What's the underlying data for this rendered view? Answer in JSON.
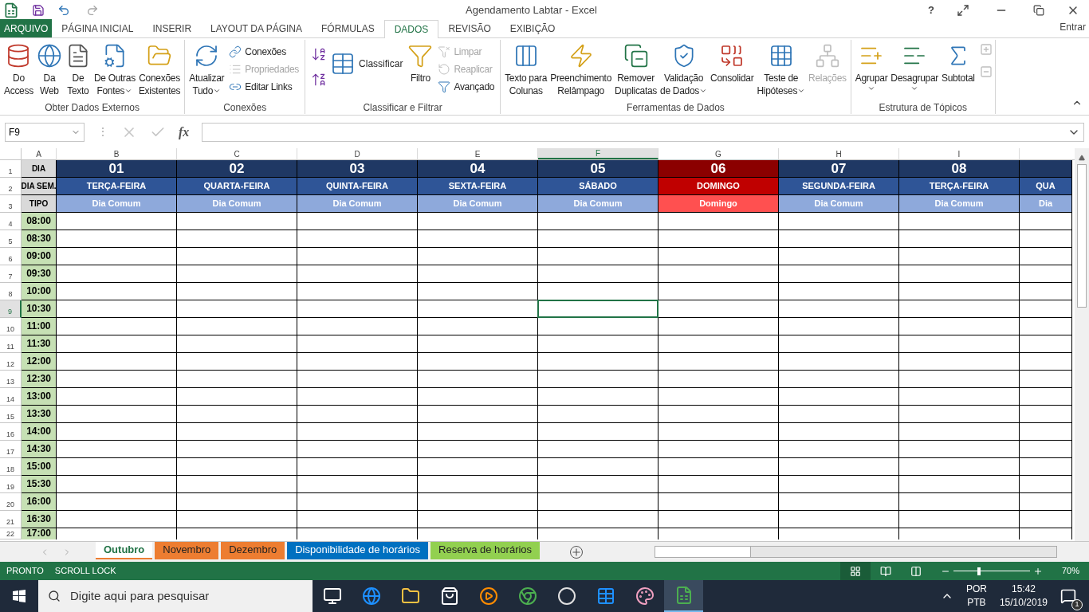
{
  "window": {
    "title": "Agendamento Labtar - Excel",
    "help": "?",
    "sign_in": "Entrar"
  },
  "tabs": [
    {
      "label": "ARQUIVO",
      "kind": "file",
      "selected": false
    },
    {
      "label": "PÁGINA INICIAL",
      "kind": "normal",
      "selected": false
    },
    {
      "label": "INSERIR",
      "kind": "normal",
      "selected": false
    },
    {
      "label": "LAYOUT DA PÁGINA",
      "kind": "normal",
      "selected": false
    },
    {
      "label": "FÓRMULAS",
      "kind": "normal",
      "selected": false
    },
    {
      "label": "DADOS",
      "kind": "normal",
      "selected": true
    },
    {
      "label": "REVISÃO",
      "kind": "normal",
      "selected": false
    },
    {
      "label": "EXIBIÇÃO",
      "kind": "normal",
      "selected": false
    }
  ],
  "ribbon": {
    "groups": [
      {
        "label": "Obter Dados Externos",
        "items": [
          {
            "kind": "large",
            "lines": [
              "Do",
              "Access"
            ],
            "dropdown": false,
            "disabled": false
          },
          {
            "kind": "large",
            "lines": [
              "Da",
              "Web"
            ],
            "dropdown": false,
            "disabled": false
          },
          {
            "kind": "large",
            "lines": [
              "De",
              "Texto"
            ],
            "dropdown": false,
            "disabled": false
          },
          {
            "kind": "large",
            "lines": [
              "De Outras",
              "Fontes"
            ],
            "dropdown": true,
            "disabled": false
          },
          {
            "kind": "large",
            "lines": [
              "Conexões",
              "Existentes"
            ],
            "dropdown": false,
            "disabled": false
          }
        ]
      },
      {
        "label": "Conexões",
        "items": [
          {
            "kind": "large",
            "lines": [
              "Atualizar",
              "Tudo"
            ],
            "dropdown": true,
            "disabled": false
          },
          {
            "kind": "small",
            "lines": [
              "Conexões"
            ],
            "dropdown": false,
            "disabled": false
          },
          {
            "kind": "small",
            "lines": [
              "Propriedades"
            ],
            "dropdown": false,
            "disabled": true
          },
          {
            "kind": "small",
            "lines": [
              "Editar Links"
            ],
            "dropdown": false,
            "disabled": false
          }
        ]
      },
      {
        "label": "Classificar e Filtrar",
        "items": [
          {
            "kind": "sortpair"
          },
          {
            "kind": "mid",
            "lines": [
              "Classificar"
            ],
            "dropdown": false,
            "disabled": false
          },
          {
            "kind": "large",
            "lines": [
              "Filtro"
            ],
            "dropdown": false,
            "disabled": false
          },
          {
            "kind": "small",
            "lines": [
              "Limpar"
            ],
            "dropdown": false,
            "disabled": true
          },
          {
            "kind": "small",
            "lines": [
              "Reaplicar"
            ],
            "dropdown": false,
            "disabled": true
          },
          {
            "kind": "small",
            "lines": [
              "Avançado"
            ],
            "dropdown": false,
            "disabled": false
          }
        ]
      },
      {
        "label": "Ferramentas de Dados",
        "items": [
          {
            "kind": "large",
            "lines": [
              "Texto para",
              "Colunas"
            ],
            "dropdown": false,
            "disabled": false
          },
          {
            "kind": "large",
            "lines": [
              "Preenchimento",
              "Relâmpago"
            ],
            "dropdown": false,
            "disabled": false
          },
          {
            "kind": "large",
            "lines": [
              "Remover",
              "Duplicatas"
            ],
            "dropdown": false,
            "disabled": false
          },
          {
            "kind": "large",
            "lines": [
              "Validação",
              "de Dados"
            ],
            "dropdown": true,
            "disabled": false
          },
          {
            "kind": "large",
            "lines": [
              "Consolidar"
            ],
            "dropdown": false,
            "disabled": false
          },
          {
            "kind": "large",
            "lines": [
              "Teste de",
              "Hipóteses"
            ],
            "dropdown": true,
            "disabled": false
          },
          {
            "kind": "large",
            "lines": [
              "Relações"
            ],
            "dropdown": false,
            "disabled": true
          }
        ]
      },
      {
        "label": "Estrutura de Tópicos",
        "items": [
          {
            "kind": "large",
            "lines": [
              "Agrupar"
            ],
            "dropdown": true,
            "disabled": false
          },
          {
            "kind": "large",
            "lines": [
              "Desagrupar"
            ],
            "dropdown": true,
            "disabled": false
          },
          {
            "kind": "large",
            "lines": [
              "Subtotal"
            ],
            "dropdown": false,
            "disabled": false
          },
          {
            "kind": "detail",
            "disabled": true
          }
        ]
      }
    ]
  },
  "formula_bar": {
    "name_box": "F9",
    "separator": "⋮",
    "function_label": "fx"
  },
  "sheet": {
    "columns": [
      {
        "letter": "A",
        "selected": false
      },
      {
        "letter": "B",
        "selected": false
      },
      {
        "letter": "C",
        "selected": false
      },
      {
        "letter": "D",
        "selected": false
      },
      {
        "letter": "E",
        "selected": false
      },
      {
        "letter": "F",
        "selected": true
      },
      {
        "letter": "G",
        "selected": false
      },
      {
        "letter": "H",
        "selected": false
      },
      {
        "letter": "I",
        "selected": false
      }
    ],
    "header_labels": [
      "DIA",
      "DIA SEM.",
      "TIPO"
    ],
    "days": [
      {
        "day": "01",
        "weekday": "TERÇA-FEIRA",
        "type": "Dia Comum",
        "kind": "weekday"
      },
      {
        "day": "02",
        "weekday": "QUARTA-FEIRA",
        "type": "Dia Comum",
        "kind": "weekday"
      },
      {
        "day": "03",
        "weekday": "QUINTA-FEIRA",
        "type": "Dia Comum",
        "kind": "weekday"
      },
      {
        "day": "04",
        "weekday": "SEXTA-FEIRA",
        "type": "Dia Comum",
        "kind": "weekday"
      },
      {
        "day": "05",
        "weekday": "SÁBADO",
        "type": "Dia Comum",
        "kind": "weekday"
      },
      {
        "day": "06",
        "weekday": "DOMINGO",
        "type": "Domingo",
        "kind": "sunday"
      },
      {
        "day": "07",
        "weekday": "SEGUNDA-FEIRA",
        "type": "Dia Comum",
        "kind": "weekday"
      },
      {
        "day": "08",
        "weekday": "TERÇA-FEIRA",
        "type": "Dia Comum",
        "kind": "weekday"
      },
      {
        "weekday": "QUA",
        "type": "Dia",
        "kind": "weekday"
      }
    ],
    "rows": [
      {
        "number": "1",
        "selected": false
      },
      {
        "number": "2",
        "selected": false
      },
      {
        "number": "3",
        "selected": false
      },
      {
        "number": "4",
        "selected": false
      },
      {
        "number": "5",
        "selected": false
      },
      {
        "number": "6",
        "selected": false
      },
      {
        "number": "7",
        "selected": false
      },
      {
        "number": "8",
        "selected": false
      },
      {
        "number": "9",
        "selected": true
      },
      {
        "number": "10",
        "selected": false
      },
      {
        "number": "11",
        "selected": false
      },
      {
        "number": "12",
        "selected": false
      },
      {
        "number": "13",
        "selected": false
      },
      {
        "number": "14",
        "selected": false
      },
      {
        "number": "15",
        "selected": false
      },
      {
        "number": "16",
        "selected": false
      },
      {
        "number": "17",
        "selected": false
      },
      {
        "number": "18",
        "selected": false
      },
      {
        "number": "19",
        "selected": false
      },
      {
        "number": "20",
        "selected": false
      },
      {
        "number": "21",
        "selected": false
      },
      {
        "number": "22",
        "selected": false
      }
    ],
    "times": [
      "08:00",
      "08:30",
      "09:00",
      "09:30",
      "10:00",
      "10:30",
      "11:00",
      "11:30",
      "12:00",
      "12:30",
      "13:00",
      "13:30",
      "14:00",
      "14:30",
      "15:00",
      "15:30",
      "16:00",
      "16:30"
    ],
    "partial_time": "17:00"
  },
  "sheet_tabs": [
    {
      "label": "Outubro",
      "color": "#ffffff",
      "selected": true
    },
    {
      "label": "Novembro",
      "color": "#ed7d31",
      "selected": false
    },
    {
      "label": "Dezembro",
      "color": "#ed7d31",
      "selected": false
    },
    {
      "label": "Disponibilidade de horários",
      "color": "#0070c0",
      "selected": false
    },
    {
      "label": "Reserva de horários",
      "color": "#92d050",
      "selected": false
    }
  ],
  "status_bar": {
    "items": [
      "PRONTO",
      "SCROLL LOCK"
    ],
    "views": [
      {
        "selected": true
      },
      {
        "selected": false
      },
      {
        "selected": false
      }
    ],
    "zoom": {
      "level": 0.33,
      "label": "70%"
    }
  },
  "taskbar": {
    "search_placeholder": "Digite aqui para pesquisar",
    "apps": [
      {
        "selected": false
      },
      {
        "selected": false
      },
      {
        "selected": false
      },
      {
        "selected": false
      },
      {
        "selected": false
      },
      {
        "selected": false
      },
      {
        "selected": false
      },
      {
        "selected": false
      },
      {
        "selected": false
      },
      {
        "selected": true
      }
    ],
    "language": [
      "POR",
      "PTB"
    ],
    "time": "15:42",
    "date": "15/10/2019",
    "notifications": "1"
  }
}
